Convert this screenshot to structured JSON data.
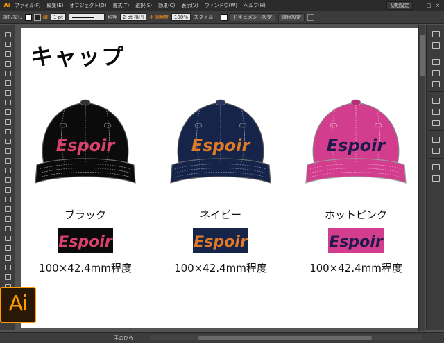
{
  "menubar": {
    "app_logo": "Ai",
    "items": [
      "ファイル(F)",
      "編集(E)",
      "オブジェクト(O)",
      "書式(T)",
      "選択(S)",
      "効果(C)",
      "表示(V)",
      "ウィンドウ(W)",
      "ヘルプ(H)"
    ],
    "workspace": "初期設定",
    "window_controls": [
      "–",
      "□",
      "×"
    ]
  },
  "controlbar": {
    "selection": "選択なし",
    "stroke_label": "線",
    "stroke_weight": "1 pt",
    "stroke_profile": "均等",
    "brush": "2 pt 楕円",
    "opacity_label": "不透明度",
    "opacity": "100%",
    "style_label": "スタイル：",
    "document_setup": "ドキュメント設定",
    "preferences": "環境設定"
  },
  "page": {
    "title": "キャップ"
  },
  "products": [
    {
      "color_name": "ブラック",
      "size": "100×42.4mm程度",
      "logo_text": "Espoir",
      "cap_color": "#0b0b0b",
      "logo_color": "#d9416e",
      "stitch_color": "#9a9a9a"
    },
    {
      "color_name": "ネイビー",
      "size": "100×42.4mm程度",
      "logo_text": "Espoir",
      "cap_color": "#172449",
      "logo_color": "#e07a26",
      "stitch_color": "#8f9abb"
    },
    {
      "color_name": "ホットピンク",
      "size": "100×42.4mm程度",
      "logo_text": "Espoir",
      "cap_color": "#d23d8e",
      "logo_color": "#1f1a4d",
      "stitch_color": "#f0a6cc"
    }
  ],
  "statusbar": {
    "tool": "手のひら"
  },
  "badge": {
    "text": "Ai"
  },
  "colors": {
    "chrome_dark": "#2b2b2b",
    "chrome_mid": "#3c3c3c",
    "canvas": "#535353",
    "accent": "#ff9a00"
  }
}
